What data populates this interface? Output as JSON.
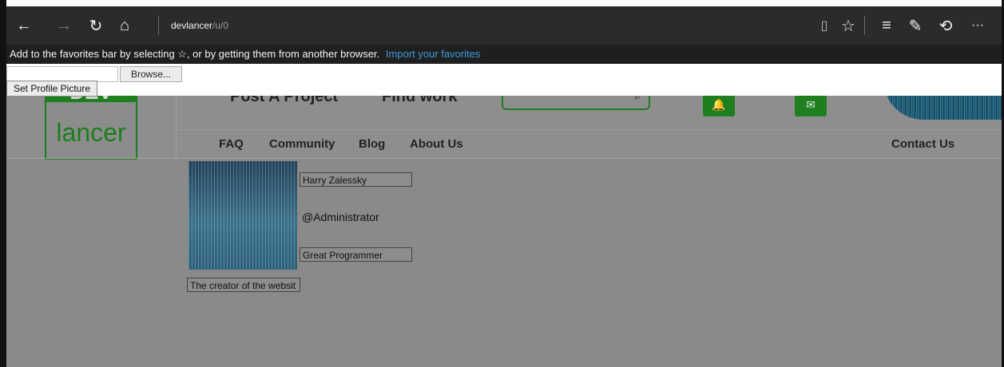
{
  "browser": {
    "address_host": "devlancer",
    "address_path": "/u/0",
    "back": "←",
    "forward": "→",
    "refresh": "↻",
    "home": "⌂",
    "reading_view": "▯",
    "favorite_star": "☆",
    "hub": "≡",
    "web_note": "✎",
    "share": "⟲",
    "more": "···"
  },
  "favbar": {
    "message": "Add to the favorites bar by selecting ☆, or by getting them from another browser.",
    "import_link": "Import your favorites"
  },
  "upload": {
    "browse_label": "Browse...",
    "set_picture_label": "Set Profile Picture"
  },
  "site": {
    "logo_top": "DEV",
    "logo_text": "lancer",
    "nav_top": [
      "Post A Project",
      "Find work"
    ],
    "nav_bottom": [
      "FAQ",
      "Community",
      "Blog",
      "About Us"
    ],
    "contact": "Contact Us",
    "bell_icon": "🔔",
    "mail_icon": "✉",
    "search_icon": "⌕"
  },
  "profile": {
    "name": "Harry Zalessky",
    "handle": "@Administrator",
    "title": "Great Programmer",
    "bio": "The creator of the websit"
  }
}
